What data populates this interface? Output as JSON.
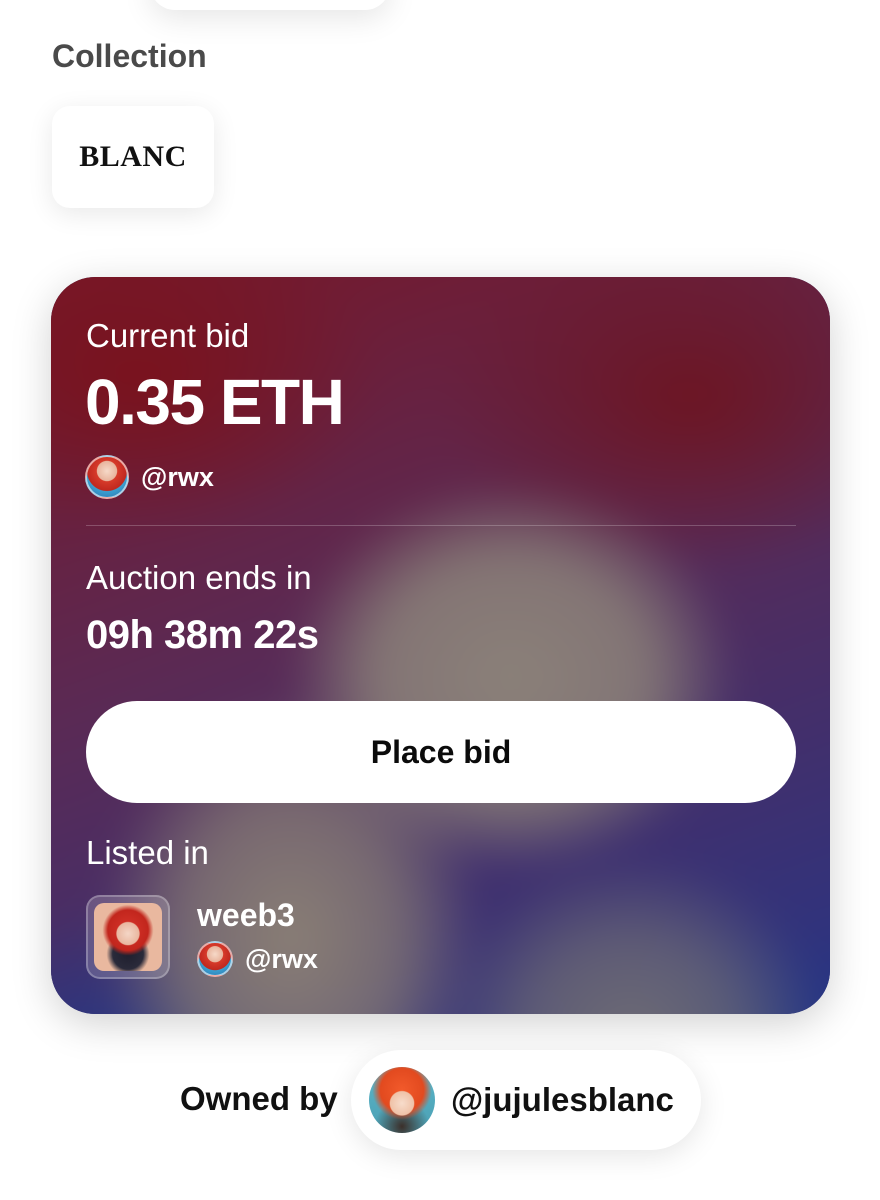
{
  "collection": {
    "title": "Collection",
    "logo_text": "BLANC"
  },
  "auction": {
    "current_bid_label": "Current bid",
    "current_bid_amount": "0.35 ETH",
    "bidder_handle": "@rwx",
    "ends_label": "Auction ends in",
    "countdown": "09h 38m 22s",
    "place_bid_label": "Place bid",
    "listed_in_label": "Listed in",
    "listed_name": "weeb3",
    "lister_handle": "@rwx"
  },
  "owner": {
    "label": "Owned by",
    "handle": "@jujulesblanc"
  },
  "colors": {
    "button_bg": "#ffffff",
    "card_text": "#ffffff",
    "accent_red": "#7d1420",
    "accent_blue": "#22368a"
  },
  "icons": {
    "bidder_avatar": "avatar-icon",
    "listing_thumb": "artwork-thumbnail",
    "owner_avatar": "avatar-icon"
  }
}
